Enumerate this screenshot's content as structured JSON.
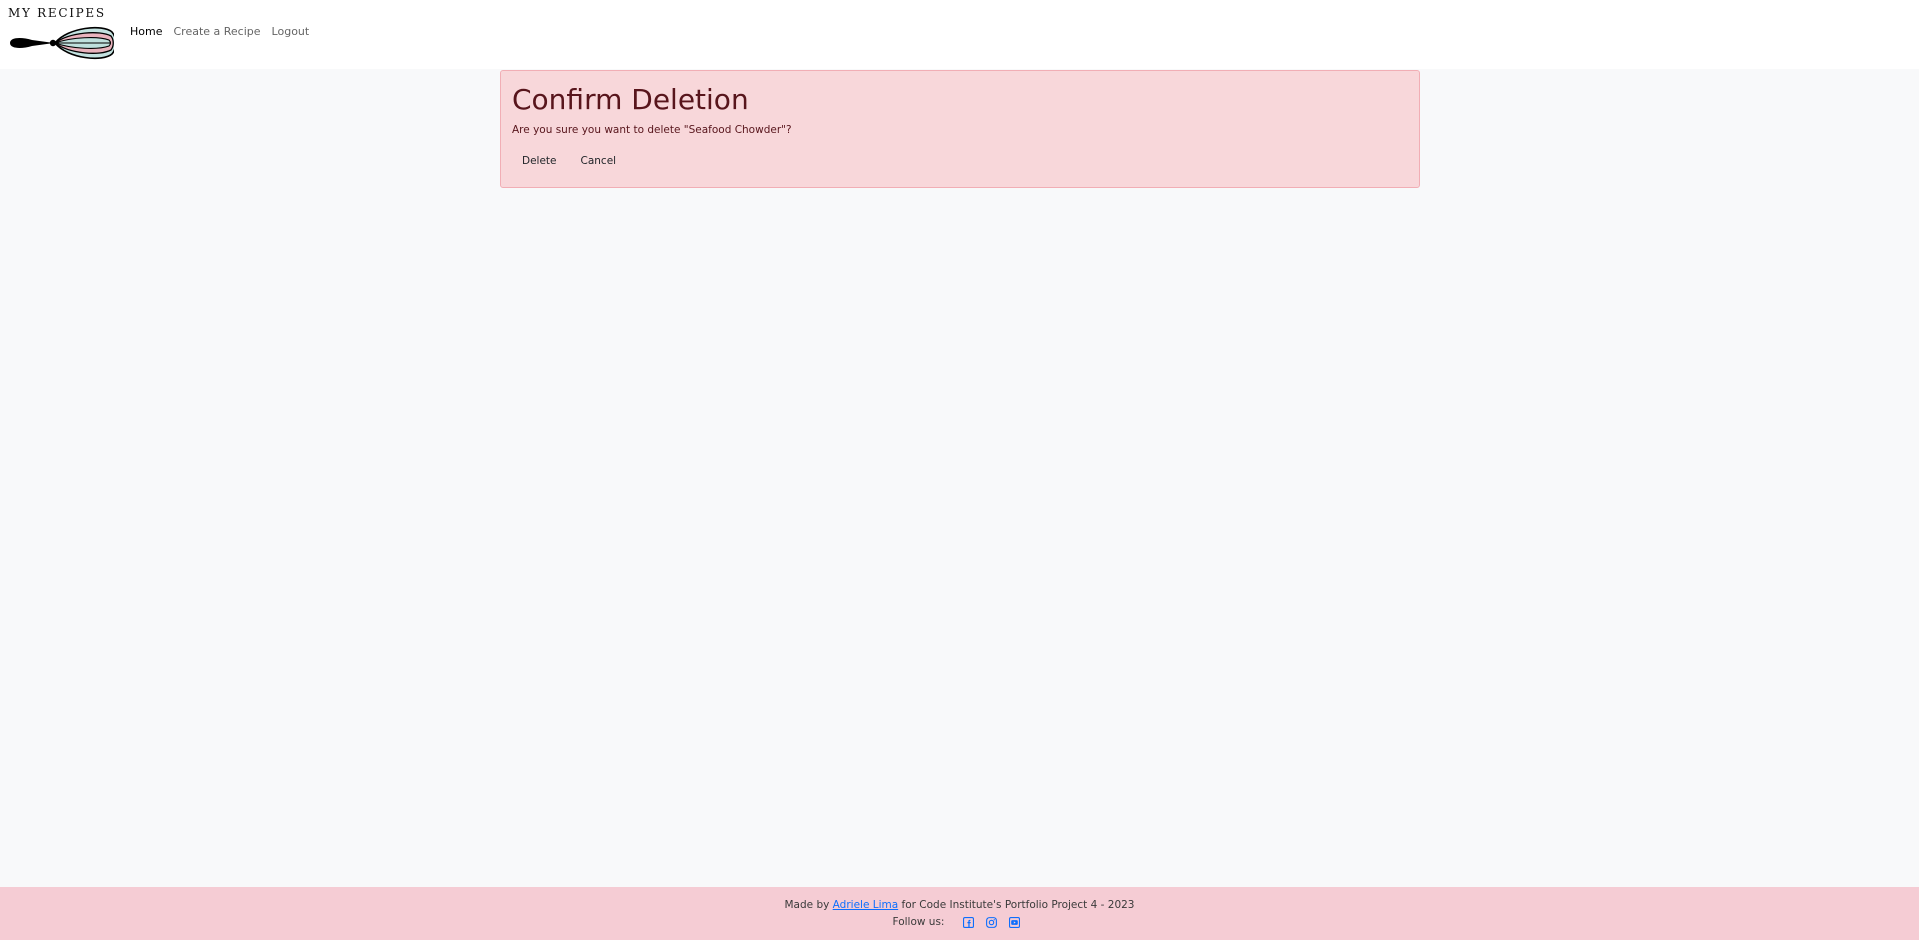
{
  "brand": {
    "name": "MY RECIPES"
  },
  "nav": {
    "items": [
      {
        "label": "Home",
        "active": true
      },
      {
        "label": "Create a Recipe",
        "active": false
      },
      {
        "label": "Logout",
        "active": false
      }
    ]
  },
  "confirm": {
    "title": "Confirm Deletion",
    "message": "Are you sure you want to delete \"Seafood Chowder\"?",
    "delete_label": "Delete",
    "cancel_label": "Cancel"
  },
  "footer": {
    "made_by_prefix": "Made by",
    "author": "Adriele Lima",
    "made_by_suffix": "for Code Institute's Portfolio Project 4 - 2023",
    "follow_label": "Follow us:",
    "socials": [
      "facebook-icon",
      "instagram-icon",
      "youtube-icon"
    ]
  },
  "colors": {
    "alert_bg": "#f8d7da",
    "alert_text": "#58151c",
    "footer_bg": "#f5ccd4",
    "link": "#0d6efd"
  }
}
